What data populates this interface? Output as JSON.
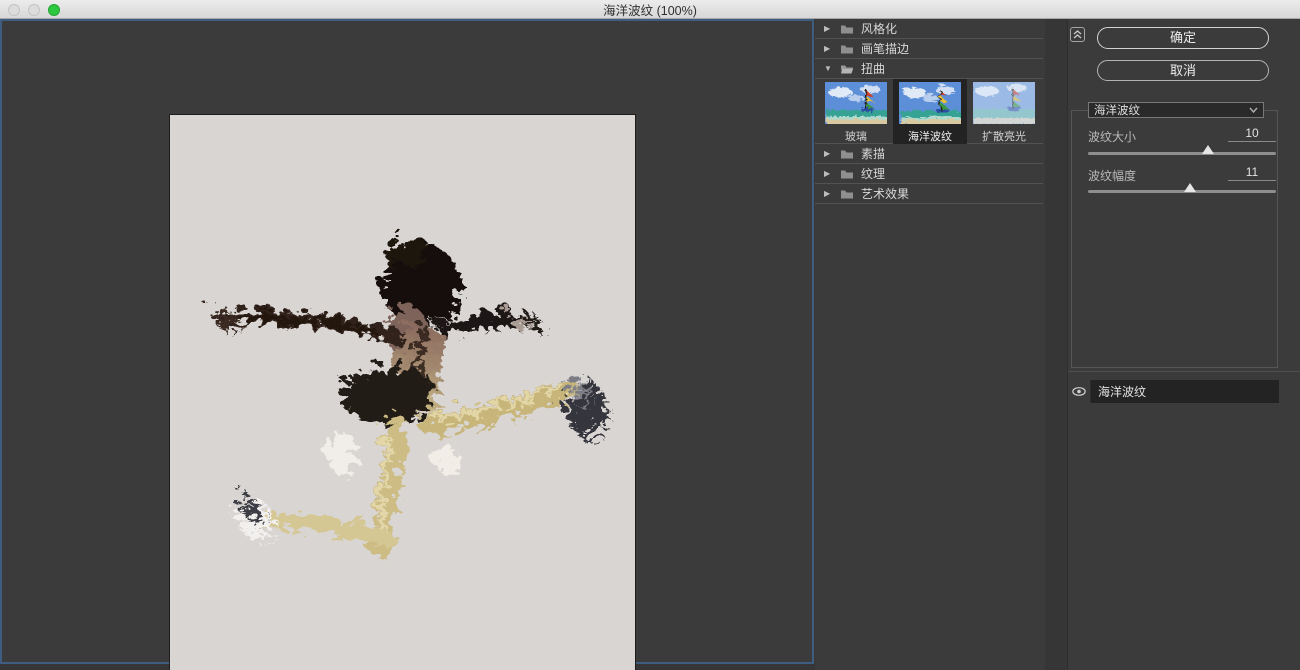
{
  "window": {
    "title": "海洋波纹 (100%)",
    "traffic_lights": [
      "close-disabled",
      "minimize-disabled",
      "zoom-enabled"
    ]
  },
  "filter_list": {
    "categories": [
      {
        "label": "风格化",
        "expanded": false
      },
      {
        "label": "画笔描边",
        "expanded": false
      },
      {
        "label": "扭曲",
        "expanded": true
      },
      {
        "label": "素描",
        "expanded": false
      },
      {
        "label": "纹理",
        "expanded": false
      },
      {
        "label": "艺术效果",
        "expanded": false
      }
    ],
    "distort_items": [
      {
        "label": "玻璃",
        "selected": false
      },
      {
        "label": "海洋波纹",
        "selected": true
      },
      {
        "label": "扩散亮光",
        "selected": false
      }
    ]
  },
  "controls": {
    "ok_label": "确定",
    "cancel_label": "取消",
    "filter_select": {
      "value": "海洋波纹"
    },
    "sliders": [
      {
        "label": "波纹大小",
        "value": "10",
        "percent": 64
      },
      {
        "label": "波纹幅度",
        "value": "11",
        "percent": 54
      }
    ]
  },
  "layers": {
    "rows": [
      {
        "label": "海洋波纹",
        "visible": true,
        "selected": true
      }
    ]
  },
  "colors": {
    "panel_bg": "#3b3b3b",
    "focus_border": "#3e5d80",
    "canvas_bg": "#d9d5d2",
    "selected_bg": "#232323",
    "traffic_green": "#2bc840"
  }
}
